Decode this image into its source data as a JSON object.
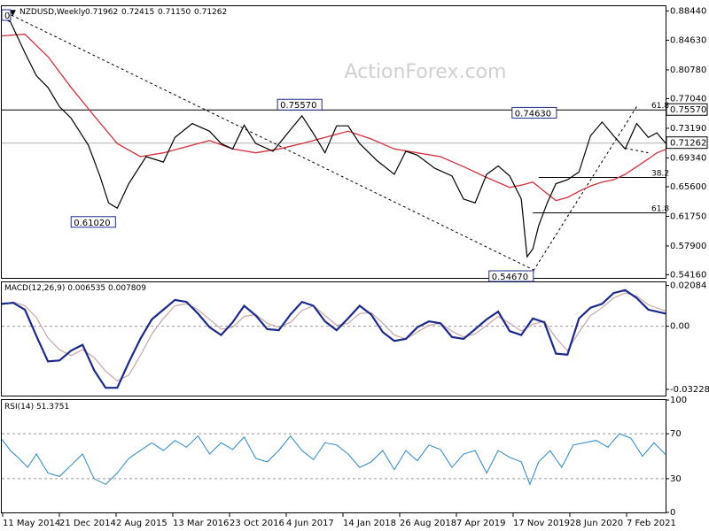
{
  "watermark": "ActionForex.com",
  "chart_data": [
    {
      "type": "line",
      "title": "NZDUSD,Weekly",
      "ohlc": [
        "0.71962",
        "0.72415",
        "0.71150",
        "0.71262"
      ],
      "ylim": [
        0.5375,
        0.8905
      ],
      "y_ticks": [
        "0.88440",
        "0.84630",
        "0.80780",
        "0.77040",
        "0.73190",
        "0.69340",
        "0.65600",
        "0.61750",
        "0.57900",
        "0.54160"
      ],
      "current_price": "0.71262",
      "level_tags": [
        "0.75570"
      ],
      "annotations": [
        {
          "text": "0",
          "x": 0.0,
          "y": 0.879
        },
        {
          "text": "0.75570",
          "x": 0.52,
          "y": 0.7557
        },
        {
          "text": "0.61020",
          "x": 0.197,
          "y": 0.6102
        },
        {
          "text": "0.54670",
          "x": 0.921,
          "y": 0.5467
        },
        {
          "text": "0.74630",
          "x": 0.961,
          "y": 0.7463
        }
      ],
      "fib_labels": [
        {
          "text": "61.8",
          "y": 0.7557
        },
        {
          "text": "38.2",
          "y": 0.668
        },
        {
          "text": "61.8",
          "y": 0.622
        }
      ],
      "lines": {
        "close_price": {
          "x": [
            0.0,
            0.015,
            0.04,
            0.06,
            0.08,
            0.1,
            0.12,
            0.15,
            0.17,
            0.185,
            0.2,
            0.22,
            0.25,
            0.28,
            0.3,
            0.33,
            0.36,
            0.38,
            0.4,
            0.42,
            0.44,
            0.47,
            0.5,
            0.52,
            0.54,
            0.56,
            0.58,
            0.6,
            0.62,
            0.65,
            0.68,
            0.7,
            0.72,
            0.75,
            0.78,
            0.8,
            0.82,
            0.84,
            0.86,
            0.88,
            0.9,
            0.91,
            0.92,
            0.93,
            0.945,
            0.96,
            0.98,
            1.0,
            1.02,
            1.04,
            1.06,
            1.08,
            1.1,
            1.12,
            1.135,
            1.15
          ],
          "y": [
            0.876,
            0.87,
            0.83,
            0.8,
            0.785,
            0.76,
            0.745,
            0.71,
            0.67,
            0.635,
            0.628,
            0.66,
            0.695,
            0.688,
            0.72,
            0.738,
            0.728,
            0.712,
            0.705,
            0.736,
            0.712,
            0.702,
            0.73,
            0.748,
            0.725,
            0.7,
            0.735,
            0.735,
            0.712,
            0.69,
            0.672,
            0.702,
            0.697,
            0.68,
            0.67,
            0.64,
            0.635,
            0.672,
            0.683,
            0.67,
            0.64,
            0.565,
            0.575,
            0.605,
            0.635,
            0.66,
            0.665,
            0.675,
            0.722,
            0.74,
            0.722,
            0.705,
            0.738,
            0.72,
            0.726,
            0.7126
          ]
        },
        "moving_average": {
          "x": [
            0.0,
            0.04,
            0.08,
            0.12,
            0.16,
            0.2,
            0.24,
            0.28,
            0.32,
            0.36,
            0.4,
            0.44,
            0.48,
            0.52,
            0.56,
            0.6,
            0.64,
            0.68,
            0.72,
            0.76,
            0.8,
            0.84,
            0.88,
            0.9,
            0.92,
            0.94,
            0.96,
            0.98,
            1.0,
            1.02,
            1.04,
            1.06,
            1.08,
            1.1,
            1.12,
            1.135,
            1.15
          ],
          "y": [
            0.852,
            0.854,
            0.825,
            0.785,
            0.748,
            0.712,
            0.695,
            0.7,
            0.708,
            0.716,
            0.705,
            0.7,
            0.705,
            0.712,
            0.72,
            0.728,
            0.718,
            0.705,
            0.7,
            0.695,
            0.682,
            0.668,
            0.655,
            0.658,
            0.662,
            0.65,
            0.638,
            0.642,
            0.65,
            0.657,
            0.662,
            0.665,
            0.672,
            0.682,
            0.692,
            0.7,
            0.7045
          ]
        },
        "trendlines": [
          {
            "x": [
              0.0,
              0.921
            ],
            "y": [
              0.885,
              0.548
            ]
          },
          {
            "x": [
              0.921,
              1.1
            ],
            "y": [
              0.5467,
              0.76
            ]
          },
          {
            "x": [
              1.08,
              1.12
            ],
            "y": [
              0.706,
              0.7
            ]
          }
        ],
        "fib_lines": [
          {
            "x": [
              0.0,
              1.15
            ],
            "y": [
              0.7557,
              0.7557
            ]
          },
          {
            "x": [
              0.0,
              1.15
            ],
            "y": [
              0.7126,
              0.7126
            ]
          },
          {
            "x": [
              0.93,
              1.15
            ],
            "y": [
              0.668,
              0.668
            ]
          },
          {
            "x": [
              0.92,
              1.15
            ],
            "y": [
              0.622,
              0.622
            ]
          }
        ]
      },
      "colors": {
        "price": "#000000",
        "ma": "#d0303a",
        "trend": "#000000",
        "fib": "#000000",
        "grid": "#808080"
      }
    },
    {
      "type": "line",
      "title": "MACD(12,26,9) 0.006535 0.007809",
      "ylim": [
        -0.0355,
        0.0225
      ],
      "y_ticks": [
        "0.02084",
        "0.00",
        "-0.032285"
      ],
      "x": [
        0.0,
        0.02,
        0.04,
        0.06,
        0.08,
        0.1,
        0.12,
        0.14,
        0.16,
        0.18,
        0.2,
        0.22,
        0.24,
        0.26,
        0.28,
        0.3,
        0.32,
        0.34,
        0.36,
        0.38,
        0.4,
        0.42,
        0.44,
        0.46,
        0.48,
        0.5,
        0.52,
        0.54,
        0.56,
        0.58,
        0.6,
        0.62,
        0.64,
        0.66,
        0.68,
        0.7,
        0.72,
        0.74,
        0.76,
        0.78,
        0.8,
        0.82,
        0.84,
        0.86,
        0.88,
        0.9,
        0.92,
        0.94,
        0.96,
        0.98,
        1.0,
        1.02,
        1.04,
        1.06,
        1.08,
        1.1,
        1.12,
        1.15
      ],
      "series": [
        {
          "name": "MACD",
          "values": [
            0.0115,
            0.012,
            0.0085,
            -0.005,
            -0.018,
            -0.0175,
            -0.0125,
            -0.0095,
            -0.0225,
            -0.0315,
            -0.0315,
            -0.0185,
            -0.0065,
            0.0035,
            0.0085,
            0.0135,
            0.0125,
            0.0065,
            -0.0005,
            -0.0045,
            0.002,
            0.0105,
            0.0055,
            -0.0015,
            -0.002,
            0.006,
            0.0125,
            0.0105,
            0.0025,
            -0.002,
            0.004,
            0.0105,
            0.006,
            -0.003,
            -0.0075,
            -0.0065,
            -0.0005,
            0.0025,
            0.0015,
            -0.0055,
            -0.0065,
            -0.0015,
            0.0035,
            0.0075,
            -0.0025,
            -0.0045,
            0.004,
            0.002,
            -0.014,
            -0.0145,
            0.004,
            0.0095,
            0.0115,
            0.017,
            0.0185,
            0.0145,
            0.0085,
            0.0065
          ]
        },
        {
          "name": "Signal",
          "values": [
            0.011,
            0.0125,
            0.0105,
            0.0045,
            -0.006,
            -0.012,
            -0.015,
            -0.012,
            -0.016,
            -0.023,
            -0.028,
            -0.025,
            -0.015,
            -0.004,
            0.004,
            0.0105,
            0.0115,
            0.0085,
            0.0035,
            -0.0015,
            -0.0005,
            0.005,
            0.006,
            0.0015,
            -0.0005,
            0.002,
            0.008,
            0.0105,
            0.0055,
            0.0005,
            0.0015,
            0.0065,
            0.007,
            0.0015,
            -0.0045,
            -0.0065,
            -0.003,
            0.0005,
            0.0015,
            -0.0025,
            -0.0055,
            -0.004,
            0.0005,
            0.005,
            0.0015,
            -0.0025,
            0.001,
            0.0025,
            -0.006,
            -0.0125,
            -0.003,
            0.0055,
            0.0095,
            0.0145,
            0.017,
            0.0155,
            0.011,
            0.0078
          ]
        }
      ],
      "colors": {
        "macd": "#1b2a8a",
        "signal": "#c7a6a6"
      }
    },
    {
      "type": "line",
      "title": "RSI(14) 51.3751",
      "ylim": [
        0,
        100
      ],
      "y_ticks": [
        "100",
        "70",
        "30",
        "0"
      ],
      "x": [
        0.0,
        0.015,
        0.03,
        0.045,
        0.06,
        0.08,
        0.1,
        0.12,
        0.14,
        0.16,
        0.18,
        0.2,
        0.22,
        0.24,
        0.26,
        0.28,
        0.3,
        0.32,
        0.34,
        0.36,
        0.38,
        0.4,
        0.42,
        0.44,
        0.46,
        0.48,
        0.5,
        0.52,
        0.54,
        0.56,
        0.58,
        0.6,
        0.62,
        0.64,
        0.66,
        0.68,
        0.7,
        0.72,
        0.74,
        0.76,
        0.78,
        0.8,
        0.82,
        0.84,
        0.86,
        0.88,
        0.9,
        0.915,
        0.93,
        0.95,
        0.97,
        0.99,
        1.01,
        1.03,
        1.05,
        1.07,
        1.09,
        1.11,
        1.13,
        1.15
      ],
      "series": [
        {
          "name": "RSI",
          "values": [
            65,
            55,
            48,
            40,
            52,
            35,
            32,
            42,
            52,
            30,
            25,
            35,
            48,
            55,
            62,
            55,
            64,
            58,
            68,
            52,
            62,
            56,
            67,
            48,
            45,
            55,
            68,
            55,
            47,
            62,
            60,
            52,
            40,
            45,
            55,
            38,
            55,
            46,
            60,
            56,
            40,
            52,
            55,
            35,
            55,
            49,
            45,
            25,
            45,
            55,
            40,
            60,
            62,
            64,
            58,
            70,
            66,
            50,
            62,
            51.4
          ]
        }
      ],
      "colors": {
        "rsi": "#2a86c8"
      }
    }
  ],
  "x_axis_labels": [
    "11 May 2014",
    "21 Dec 2014",
    "2 Aug 2015",
    "13 Mar 2016",
    "23 Oct 2016",
    "4 Jun 2017",
    "14 Jan 2018",
    "26 Aug 2018",
    "7 Apr 2019",
    "17 Nov 2019",
    "28 Jun 2020",
    "7 Feb 2021"
  ]
}
